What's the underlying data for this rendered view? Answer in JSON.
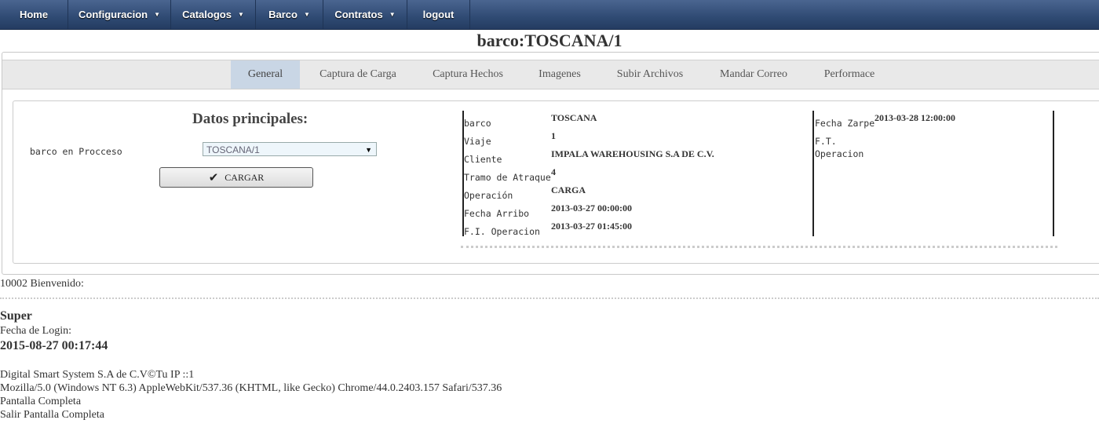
{
  "nav": {
    "items": [
      {
        "label": "Home",
        "caret": ""
      },
      {
        "label": "Configuracion",
        "caret": "▼"
      },
      {
        "label": "Catalogos",
        "caret": "▼"
      },
      {
        "label": "Barco",
        "caret": "▼"
      },
      {
        "label": "Contratos",
        "caret": "▼"
      },
      {
        "label": "logout",
        "caret": ""
      }
    ]
  },
  "page_title": "barco:TOSCANA/1",
  "tabs": [
    {
      "label": "General",
      "active": true
    },
    {
      "label": "Captura de Carga"
    },
    {
      "label": "Captura Hechos"
    },
    {
      "label": "Imagenes"
    },
    {
      "label": "Subir Archivos"
    },
    {
      "label": "Mandar Correo"
    },
    {
      "label": "Performace"
    }
  ],
  "datos": {
    "title": "Datos principales:",
    "select_label": "barco en Procceso",
    "select_value": "TOSCANA/1",
    "cargar_label": "CARGAR",
    "check_icon": "check-icon"
  },
  "info": {
    "barco_label": "barco",
    "barco_value": "TOSCANA",
    "viaje_label": "Viaje",
    "viaje_value": "1",
    "cliente_label": "Cliente",
    "cliente_value": "IMPALA WAREHOUSING S.A DE C.V.",
    "tramo_label": "Tramo de Atraque",
    "tramo_value": "4",
    "operacion_label": "Operación",
    "operacion_value": "CARGA",
    "arribo_label": "Fecha Arribo",
    "arribo_value": "2013-03-27 00:00:00",
    "fi_label": "F.I. Operacion",
    "fi_value": "2013-03-27 01:45:00",
    "zarpe_label": "Fecha Zarpe",
    "zarpe_value": "2013-03-28 12:00:00",
    "ft_label_1": "F.T.",
    "ft_label_2": "Operacion"
  },
  "footer": {
    "welcome": "10002 Bienvenido:",
    "user": "Super",
    "login_label": "Fecha de Login:",
    "login_date": "2015-08-27 00:17:44",
    "company": "Digital Smart System S.A de C.V©Tu IP ::1",
    "user_agent": "Mozilla/5.0 (Windows NT 6.3) AppleWebKit/537.36 (KHTML, like Gecko) Chrome/44.0.2403.157 Safari/537.36",
    "fullscreen": "Pantalla Completa",
    "exit_fullscreen": "Salir Pantalla Completa"
  }
}
